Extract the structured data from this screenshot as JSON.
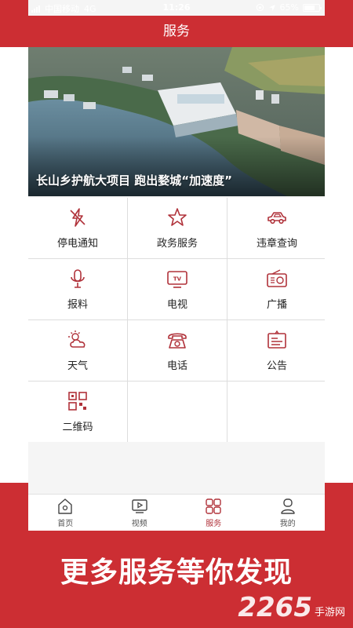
{
  "status": {
    "carrier": "中国移动",
    "network": "4G",
    "time": "11:26",
    "battery": "65%"
  },
  "header": {
    "title": "服务"
  },
  "banner": {
    "caption": "长山乡护航大项目 跑出婺城“加速度”"
  },
  "services": [
    {
      "label": "停电通知",
      "icon": "power-outage-icon"
    },
    {
      "label": "政务服务",
      "icon": "star-icon"
    },
    {
      "label": "违章查询",
      "icon": "car-icon"
    },
    {
      "label": "报料",
      "icon": "microphone-icon"
    },
    {
      "label": "电视",
      "icon": "tv-icon"
    },
    {
      "label": "广播",
      "icon": "radio-icon"
    },
    {
      "label": "天气",
      "icon": "weather-icon"
    },
    {
      "label": "电话",
      "icon": "telephone-icon"
    },
    {
      "label": "公告",
      "icon": "notice-icon"
    },
    {
      "label": "二维码",
      "icon": "qr-code-icon"
    }
  ],
  "tabs": [
    {
      "label": "首页",
      "icon": "home-icon"
    },
    {
      "label": "视频",
      "icon": "video-icon"
    },
    {
      "label": "服务",
      "icon": "services-icon",
      "active": true
    },
    {
      "label": "我的",
      "icon": "profile-icon"
    }
  ],
  "promo": {
    "text": "更多服务等你发现"
  },
  "watermark": {
    "number": "2265",
    "text": "手游网"
  },
  "colors": {
    "brand_red": "#cc2e33",
    "icon_red": "#b0323a"
  }
}
